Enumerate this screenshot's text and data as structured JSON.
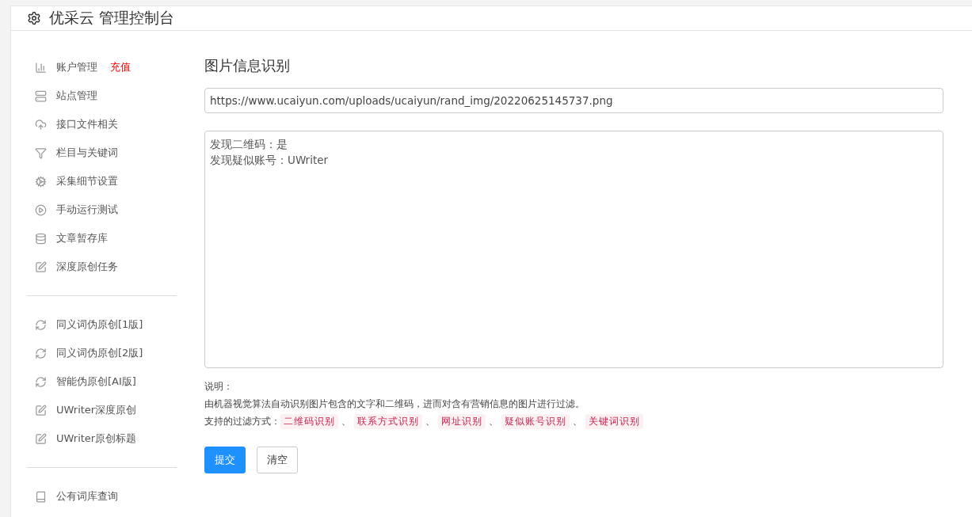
{
  "header": {
    "title": "优采云 管理控制台"
  },
  "sidebar": {
    "groups": [
      {
        "items": [
          {
            "label": "账户管理",
            "badge": "充值"
          },
          {
            "label": "站点管理"
          },
          {
            "label": "接口文件相关"
          },
          {
            "label": "栏目与关键词"
          },
          {
            "label": "采集细节设置"
          },
          {
            "label": "手动运行测试"
          },
          {
            "label": "文章暂存库"
          },
          {
            "label": "深度原创任务"
          }
        ]
      },
      {
        "items": [
          {
            "label": "同义词伪原创[1版]"
          },
          {
            "label": "同义词伪原创[2版]"
          },
          {
            "label": "智能伪原创[AI版]"
          },
          {
            "label": "UWriter深度原创"
          },
          {
            "label": "UWriter原创标题"
          }
        ]
      },
      {
        "items": [
          {
            "label": "公有词库查询"
          }
        ]
      }
    ]
  },
  "main": {
    "title": "图片信息识别",
    "url_field": {
      "value": "https://www.ucaiyun.com/uploads/ucaiyun/rand_img/20220625145737.png"
    },
    "result_box": {
      "lines": [
        "发现二维码：是",
        "发现疑似账号：UWriter"
      ]
    },
    "notes": {
      "heading": "说明：",
      "description": "由机器视觉算法自动识别图片包含的文字和二维码，进而对含有营销信息的图片进行过滤。",
      "filters_label": "支持的过滤方式：",
      "filters": [
        {
          "label": "二维码识别",
          "separator": "、"
        },
        {
          "label": "联系方式识别",
          "separator": "、"
        },
        {
          "label": "网址识别",
          "separator": "、"
        },
        {
          "label": "疑似账号识别",
          "separator": "、"
        },
        {
          "label": "关键词识别"
        }
      ]
    },
    "buttons": [
      {
        "label": "提交",
        "kind": "primary"
      },
      {
        "label": "清空",
        "kind": "default"
      }
    ]
  }
}
